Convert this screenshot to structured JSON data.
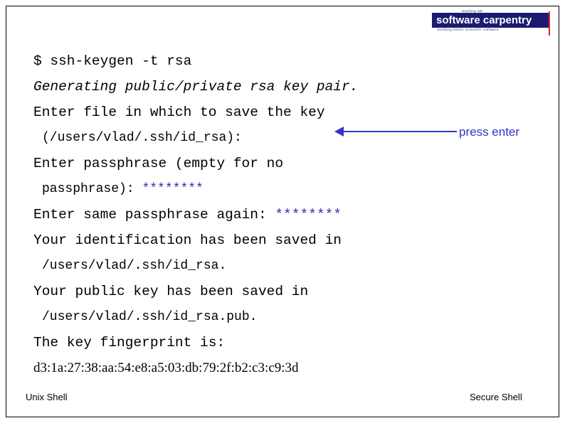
{
  "logo": {
    "word1": "software",
    "word2": "carpentry",
    "tagline": "building better scientific software",
    "top_label": "teaching lab"
  },
  "terminal": {
    "lines": [
      {
        "text": "$ ssh-keygen -t rsa",
        "style": "prompt"
      },
      {
        "text": "Generating public/private rsa key pair.",
        "style": "italic"
      },
      {
        "text": "Enter file in which to save the key",
        "style": "plain"
      },
      {
        "text": "(/users/vlad/.ssh/id_rsa):",
        "style": "indent"
      },
      {
        "text": "Enter passphrase (empty for no",
        "style": "plain"
      },
      {
        "text": "passphrase): ",
        "stars": "********",
        "style": "indent-stars"
      },
      {
        "text": "Enter same passphrase again: ",
        "stars": "********",
        "style": "plain-stars"
      },
      {
        "text": "Your identification has been saved in",
        "style": "plain"
      },
      {
        "text": "/users/vlad/.ssh/id_rsa.",
        "style": "indent"
      },
      {
        "text": "Your public key has been saved in",
        "style": "plain"
      },
      {
        "text": "/users/vlad/.ssh/id_rsa.pub.",
        "style": "indent"
      },
      {
        "text": "The key fingerprint is:",
        "style": "plain"
      },
      {
        "text": "d3:1a:27:38:aa:54:e8:a5:03:db:79:2f:b2:c3:c9:3d",
        "style": "fingerprint"
      }
    ]
  },
  "annotation": {
    "label": "press enter",
    "color": "#3333cc"
  },
  "footer": {
    "left": "Unix Shell",
    "right": "Secure Shell"
  }
}
